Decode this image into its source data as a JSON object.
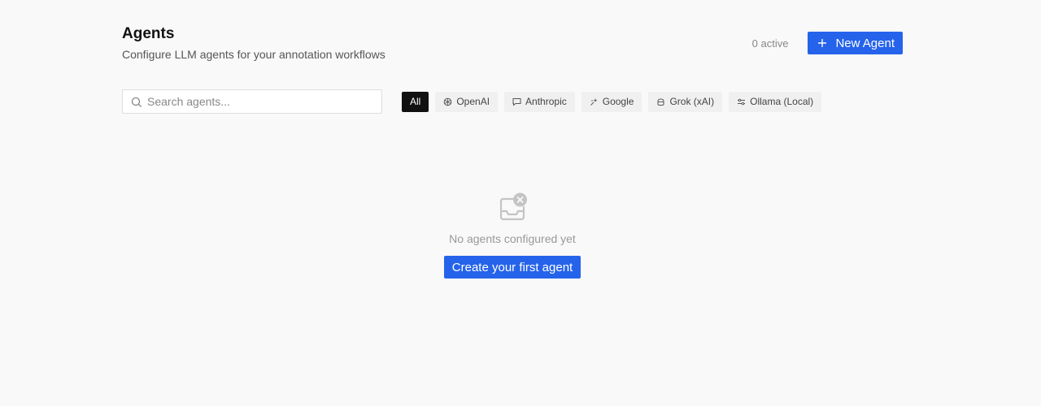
{
  "header": {
    "title": "Agents",
    "subtitle": "Configure LLM agents for your annotation workflows",
    "active_count": "0 active",
    "new_agent_label": "New Agent"
  },
  "search": {
    "placeholder": "Search agents...",
    "value": ""
  },
  "filters": [
    {
      "label": "All",
      "icon": "none",
      "active": true
    },
    {
      "label": "OpenAI",
      "icon": "openai-icon",
      "active": false
    },
    {
      "label": "Anthropic",
      "icon": "chat-bubble-icon",
      "active": false
    },
    {
      "label": "Google",
      "icon": "sparkle-icon",
      "active": false
    },
    {
      "label": "Grok (xAI)",
      "icon": "grok-icon",
      "active": false
    },
    {
      "label": "Ollama (Local)",
      "icon": "sliders-icon",
      "active": false
    }
  ],
  "empty_state": {
    "icon": "empty-inbox-icon",
    "message": "No agents configured yet",
    "cta_label": "Create your first agent"
  },
  "colors": {
    "primary": "#2563eb",
    "background": "#f9f9f9",
    "chip_active": "#111111",
    "chip_default": "#f0f0f0"
  }
}
